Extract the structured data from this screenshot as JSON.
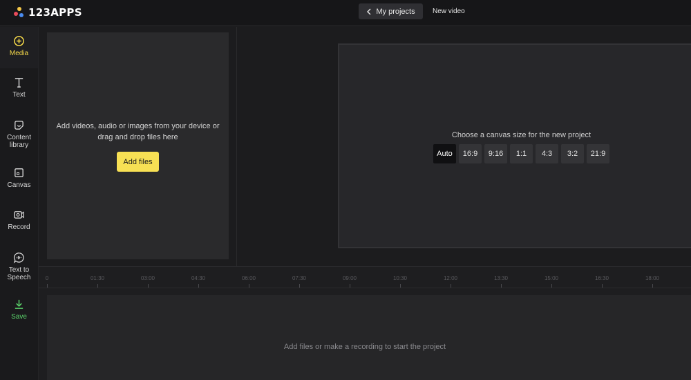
{
  "app": {
    "logo_text": "123APPS",
    "logo_dot_colors": [
      "#f7c948",
      "#e94b5a",
      "#4a8cf0",
      "#f7e054"
    ]
  },
  "header": {
    "back_label": "My projects",
    "project_name": "New video"
  },
  "sidebar": {
    "items": [
      {
        "label": "Media",
        "icon": "plus-circle-icon",
        "active": true
      },
      {
        "label": "Text",
        "icon": "text-icon"
      },
      {
        "label": "Content library",
        "icon": "sticker-icon"
      },
      {
        "label": "Canvas",
        "icon": "canvas-icon"
      },
      {
        "label": "Record",
        "icon": "record-icon"
      },
      {
        "label": "Text to Speech",
        "icon": "speech-icon"
      },
      {
        "label": "Save",
        "icon": "download-icon",
        "accent": "#5ad26a"
      }
    ]
  },
  "media_panel": {
    "description": "Add videos, audio or images from your device or drag and drop files here",
    "add_button": "Add files"
  },
  "canvas": {
    "title": "Choose a canvas size for the new project",
    "sizes": [
      "Auto",
      "16:9",
      "9:16",
      "1:1",
      "4:3",
      "3:2",
      "21:9"
    ],
    "selected": "Auto"
  },
  "timeline": {
    "ticks": [
      "0",
      "01:30",
      "03:00",
      "04:30",
      "06:00",
      "07:30",
      "09:00",
      "10:30",
      "12:00",
      "13:30",
      "15:00",
      "16:30",
      "18:00"
    ],
    "empty_text": "Add files or make a recording to start the project"
  },
  "colors": {
    "accent_yellow": "#f7e054",
    "save_green": "#5ad26a",
    "background": "#1c1c1e"
  }
}
